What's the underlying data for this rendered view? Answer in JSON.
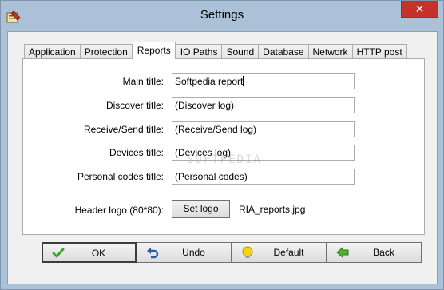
{
  "window": {
    "title": "Settings",
    "close_symbol": "✕",
    "app_icon": "settings-app-icon"
  },
  "tabs": [
    {
      "label": "Application"
    },
    {
      "label": "Protection"
    },
    {
      "label": "Reports",
      "active": true
    },
    {
      "label": "IO Paths"
    },
    {
      "label": "Sound"
    },
    {
      "label": "Database"
    },
    {
      "label": "Network"
    },
    {
      "label": "HTTP post"
    }
  ],
  "reports": {
    "fields": [
      {
        "label": "Main title:",
        "value": "Softpedia report"
      },
      {
        "label": "Discover title:",
        "value": "(Discover log)"
      },
      {
        "label": "Receive/Send title:",
        "value": "(Receive/Send log)"
      },
      {
        "label": "Devices title:",
        "value": "(Devices log)"
      },
      {
        "label": "Personal codes title:",
        "value": "(Personal codes)"
      }
    ],
    "header_logo_label": "Header logo (80*80):",
    "set_logo_button": "Set logo",
    "logo_file": "RIA_reports.jpg"
  },
  "watermark": "SOFTPEDIA",
  "buttons": {
    "ok": "OK",
    "undo": "Undo",
    "default": "Default",
    "back": "Back"
  },
  "colors": {
    "frame": "#abc1d8",
    "close": "#c7312c",
    "ok_check": "#3aa82e",
    "undo_arrow": "#2a5aa8",
    "default_bulb": "#f7d117",
    "back_arrow": "#4fb233"
  }
}
